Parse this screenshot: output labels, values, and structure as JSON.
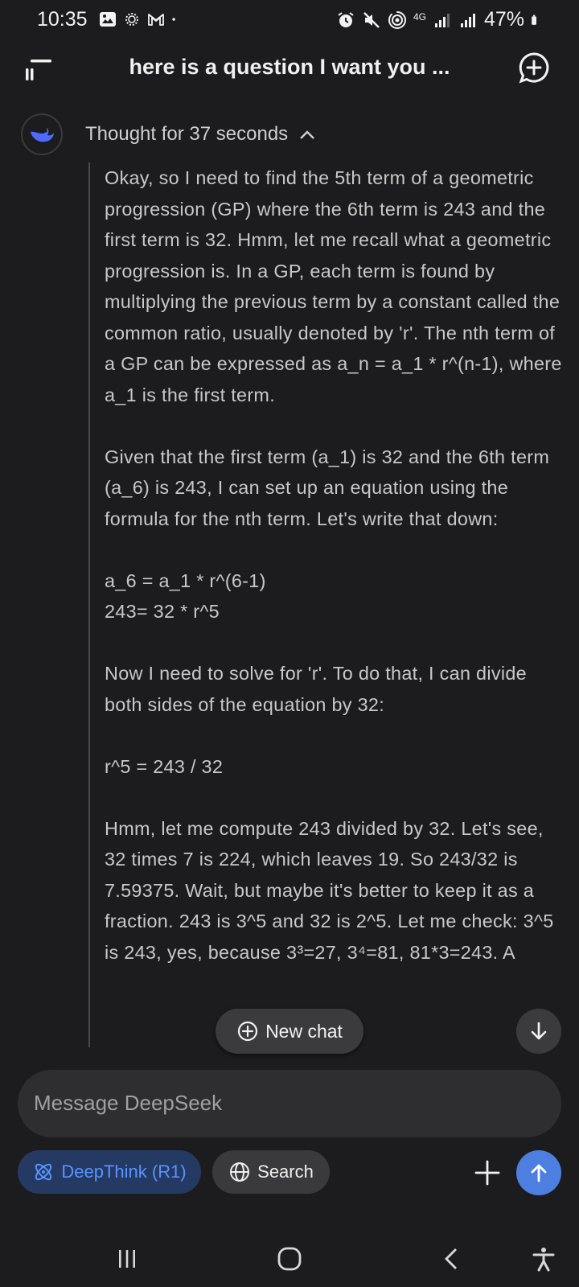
{
  "status_bar": {
    "time": "10:35",
    "battery_percent": "47%",
    "network": "4G",
    "left_icons": [
      "image-icon",
      "sun-icon",
      "gmail-icon",
      "dot-icon"
    ],
    "right_icons": [
      "alarm-icon",
      "mute-icon",
      "hotspot-icon",
      "signal-icon",
      "signal-icon",
      "battery-icon"
    ]
  },
  "header": {
    "title": "here is a question I want you ...",
    "menu_icon": "menu-icon",
    "new_chat_icon": "plus-bubble-icon"
  },
  "thought": {
    "label": "Thought for 37 seconds",
    "expanded": true,
    "paragraphs": [
      "Okay, so I need to find the 5th term of a geometric progression (GP) where the 6th term is 243 and the first term is 32. Hmm, let me recall what a geometric progression is. In a GP, each term is found by multiplying the previous term by a constant called the common ratio, usually denoted by 'r'. The nth term of a GP can be expressed as a_n = a_1 * r^(n-1), where a_1 is the first term.",
      "Given that the first term (a_1) is 32 and the 6th term (a_6) is 243, I can set up an equation using the formula for the nth term. Let's write that down:",
      "a_6 = a_1 * r^(6-1)\n243= 32 * r^5",
      "Now I need to solve for 'r'. To do that, I can divide both sides of the equation by 32:",
      "r^5 = 243 / 32",
      "Hmm, let me compute 243 divided by 32. Let's see, 32 times 7 is 224, which leaves 19. So 243/32 is 7.59375. Wait, but maybe it's better to keep it as a fraction. 243 is 3^5 and 32 is 2^5. Let me check: 3^5 is 243, yes, because 3³=27, 3⁴=81, 81*3=243. A"
    ]
  },
  "floating": {
    "new_chat_label": "New chat"
  },
  "composer": {
    "placeholder": "Message DeepSeek",
    "deepthink_label": "DeepThink (R1)",
    "search_label": "Search",
    "deepthink_active": true
  },
  "colors": {
    "background": "#1c1c1e",
    "accent": "#4d7fe0",
    "deepthink_text": "#5a93ff",
    "deepthink_bg": "#243a63"
  }
}
